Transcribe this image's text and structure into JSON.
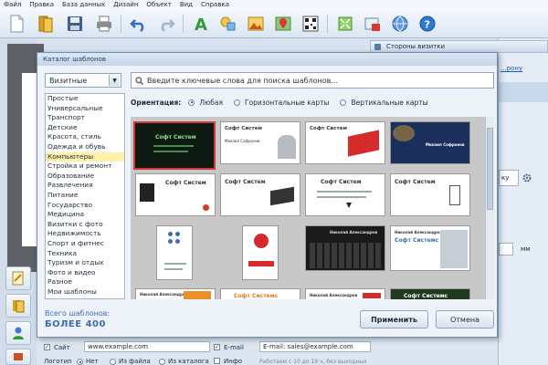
{
  "menu": [
    "Файл",
    "Правка",
    "База данных",
    "Дизайн",
    "Объект",
    "Вид",
    "Справка"
  ],
  "right_panel": {
    "header": "Стороны визитки",
    "link": "...рону",
    "field_value": "ку",
    "unit": "мм"
  },
  "dialog": {
    "title": "Каталог шаблонов",
    "category_select": "Визитные",
    "search_placeholder": "Введите ключевые слова для поиска шаблонов...",
    "orientation_label": "Ориентация:",
    "orientation_options": [
      "Любая",
      "Горизонтальные карты",
      "Вертикальные карты"
    ],
    "orientation_selected": 0,
    "categories": [
      "Простые",
      "Универсальные",
      "Транспорт",
      "Детские",
      "Красота, стиль",
      "Одежда и обувь",
      "Компьютеры",
      "Стройка и ремонт",
      "Образование",
      "Развлечения",
      "Питание",
      "Государство",
      "Медицина",
      "Визитки с фото",
      "Недвижимость",
      "Спорт и фитнес",
      "Техника",
      "Туризм и отдых",
      "Фото и видео",
      "Разное",
      "Мои шаблоны"
    ],
    "selected_category": 6,
    "total_label": "Всего шаблонов:",
    "total_value": "БОЛЕЕ 400",
    "apply_button": "Применить",
    "cancel_button": "Отмена"
  },
  "templates": {
    "company": "Софт Систем",
    "company_alt": "Софт Системс",
    "person_a": "Михаил Софронов",
    "person_b": "Николай Александров"
  },
  "bottom": {
    "site_label": "Сайт",
    "site_value": "www.example.com",
    "email_label": "E-mail",
    "email_value": "E-mail: sales@example.com",
    "logo_label": "Логотип",
    "opt_no": "Нет",
    "opt_file": "Из файла",
    "opt_catalog": "Из каталога",
    "info_label": "Инфо",
    "hours": "Работаем с 10 до 19 ч, без выходных"
  },
  "colors": {
    "accent": "#3a6eb3",
    "selection": "#fff2a8",
    "card_border_selected": "#d23a3a"
  }
}
